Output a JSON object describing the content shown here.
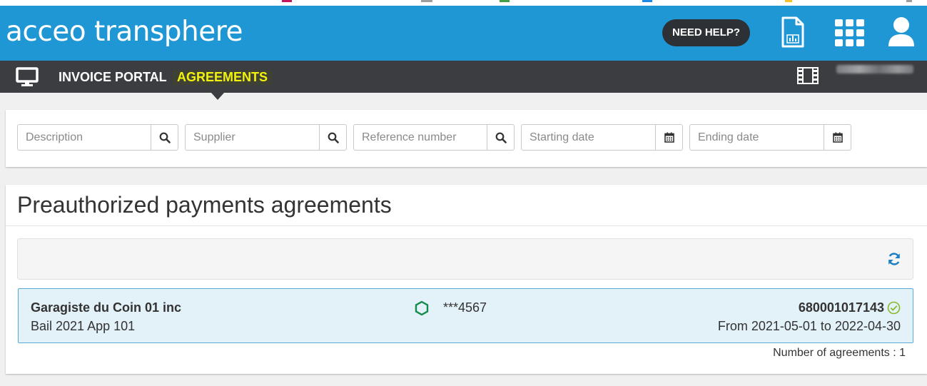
{
  "header": {
    "logo": "acceo transphere",
    "help_button": "NEED HELP?",
    "icons": [
      "report-document-icon",
      "apps-grid-icon",
      "user-profile-icon"
    ]
  },
  "nav": {
    "items": [
      {
        "label": "INVOICE PORTAL",
        "active": false
      },
      {
        "label": "AGREEMENTS",
        "active": true
      }
    ],
    "icons": [
      "monitor-icon",
      "film-icon"
    ]
  },
  "filters": {
    "description_placeholder": "Description",
    "supplier_placeholder": "Supplier",
    "reference_placeholder": "Reference number",
    "start_date_placeholder": "Starting date",
    "end_date_placeholder": "Ending date"
  },
  "panel": {
    "title": "Preauthorized payments agreements",
    "agreements": [
      {
        "supplier": "Garagiste du Coin 01 inc",
        "description": "Bail 2021 App 101",
        "account": "***4567",
        "reference": "680001017143",
        "period": "From 2021-05-01 to 2022-04-30"
      }
    ],
    "count_label": "Number of agreements : 1"
  },
  "colors": {
    "header_bg": "#1e97d4",
    "nav_bg": "#3b3d40",
    "nav_active": "#f2f20d",
    "row_bg": "#e3f1f9",
    "row_border": "#5aaad6",
    "status_green": "#8ab82a",
    "hex_green": "#168a4a"
  }
}
